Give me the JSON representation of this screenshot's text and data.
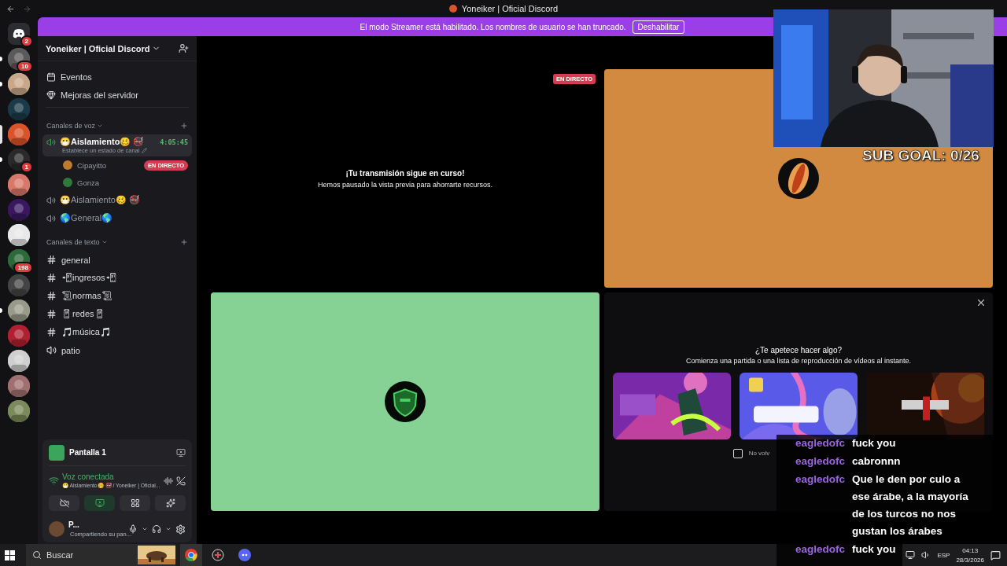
{
  "window": {
    "title": "Yoneiker | Oficial Discord"
  },
  "banner": {
    "text": "El modo Streamer está habilitado. Los nombres de usuario se han truncado.",
    "button": "Deshabilitar"
  },
  "servers": [
    {
      "kind": "home",
      "badge": "2",
      "selected": false,
      "unread": false,
      "color": "#2b2d31"
    },
    {
      "kind": "picture",
      "badge": "10",
      "selected": false,
      "unread": true,
      "color": "#5a5a5a"
    },
    {
      "kind": "picture",
      "selected": false,
      "unread": true,
      "color": "#c9a88a"
    },
    {
      "kind": "picture",
      "selected": false,
      "unread": false,
      "color": "#1a3a4a"
    },
    {
      "kind": "picture",
      "selected": true,
      "unread": false,
      "color": "#d9542a"
    },
    {
      "kind": "picture",
      "badge": "1",
      "selected": false,
      "unread": true,
      "color": "#2a2a2a"
    },
    {
      "kind": "picture",
      "selected": false,
      "unread": false,
      "color": "#d8786a"
    },
    {
      "kind": "picture",
      "selected": false,
      "unread": false,
      "color": "#3a1860"
    },
    {
      "kind": "picture",
      "selected": false,
      "unread": false,
      "color": "#e8e8e8"
    },
    {
      "kind": "picture",
      "badge": "198",
      "selected": false,
      "unread": false,
      "color": "#2d6a3a"
    },
    {
      "kind": "picture",
      "selected": false,
      "unread": false,
      "color": "#444444"
    },
    {
      "kind": "picture",
      "selected": false,
      "unread": true,
      "color": "#9a9a8a"
    },
    {
      "kind": "picture",
      "selected": false,
      "unread": false,
      "color": "#b02030"
    },
    {
      "kind": "picture",
      "selected": false,
      "unread": false,
      "color": "#cfcfcf"
    },
    {
      "kind": "picture",
      "selected": false,
      "unread": false,
      "color": "#a07070"
    },
    {
      "kind": "picture",
      "selected": false,
      "unread": false,
      "color": "#7a8a5a"
    }
  ],
  "sidebar": {
    "server_name": "Yoneiker | Oficial Discord",
    "items": [
      {
        "kind": "events",
        "label": "Eventos"
      },
      {
        "kind": "boost",
        "label": "Mejoras del servidor"
      }
    ],
    "voice_category": "Canales de voz",
    "voice_channels": [
      {
        "name": "😷Aislamiento🥴 🚭",
        "selected": true,
        "timer": "4:05:45",
        "status": "Establece un estado de canal",
        "members": [
          {
            "name": "Cipayitto",
            "live": "EN DIRECTO",
            "color": "#c07a30"
          },
          {
            "name": "Gonza",
            "color": "#2d7a3a"
          }
        ]
      },
      {
        "name": "😷Aislamiento🥴 🚭",
        "selected": false
      },
      {
        "name": "🌎General🌎",
        "selected": false
      }
    ],
    "text_category": "Canales de texto",
    "text_channels": [
      {
        "kind": "text",
        "name": "general"
      },
      {
        "kind": "text",
        "name": "📲ingresos📲"
      },
      {
        "kind": "text",
        "name": "📜normas📜"
      },
      {
        "kind": "text",
        "name": "📱redes📱"
      },
      {
        "kind": "text",
        "name": "🎵música🎵"
      },
      {
        "kind": "voice",
        "name": "patio"
      }
    ]
  },
  "panel": {
    "screen": "Pantalla 1",
    "voice_status": "Voz conectada",
    "voice_location": "😷 Aislamiento🥴 🚭 / Yoneiker | Oficial...",
    "buttons": [
      {
        "kind": "camera",
        "selected": false
      },
      {
        "kind": "screen",
        "selected": true
      },
      {
        "kind": "activities",
        "selected": false
      },
      {
        "kind": "soundboard",
        "selected": false
      }
    ],
    "user": {
      "name": "P...",
      "status": "Compartiendo su pan..."
    }
  },
  "tiles": [
    {
      "kind": "paused",
      "live": "EN DIRECTO",
      "title": "¡Tu transmisión sigue en curso!",
      "subtitle": "Hemos pausado la vista previa para ahorrarte recursos."
    },
    {
      "kind": "avatar",
      "color": "#d28a40"
    },
    {
      "kind": "avatar",
      "color": "#86d295"
    },
    {
      "kind": "activity",
      "title": "¿Te apetece hacer algo?",
      "subtitle": "Comienza una partida o una lista de reproducción de vídeos al instante.",
      "cards": [
        {
          "kind": "picture"
        },
        {
          "kind": "picture"
        },
        {
          "kind": "picture"
        }
      ],
      "checkbox": {
        "label": "No volv",
        "checked": false
      }
    }
  ],
  "overlay": {
    "goal": "SUB GOAL: 0/26",
    "chat": [
      {
        "user": "eagledofc",
        "text": "fuck you"
      },
      {
        "user": "eagledofc",
        "text": "cabronnn"
      },
      {
        "user": "eagledofc",
        "text": "Que le den por culo a ese árabe, a la mayoría de los turcos no nos gustan los árabes"
      },
      {
        "user": "eagledofc",
        "text": "fuck you"
      }
    ]
  },
  "taskbar": {
    "search": "Buscar",
    "language": "ESP",
    "time": "04:13",
    "date": "28/3/2026"
  }
}
